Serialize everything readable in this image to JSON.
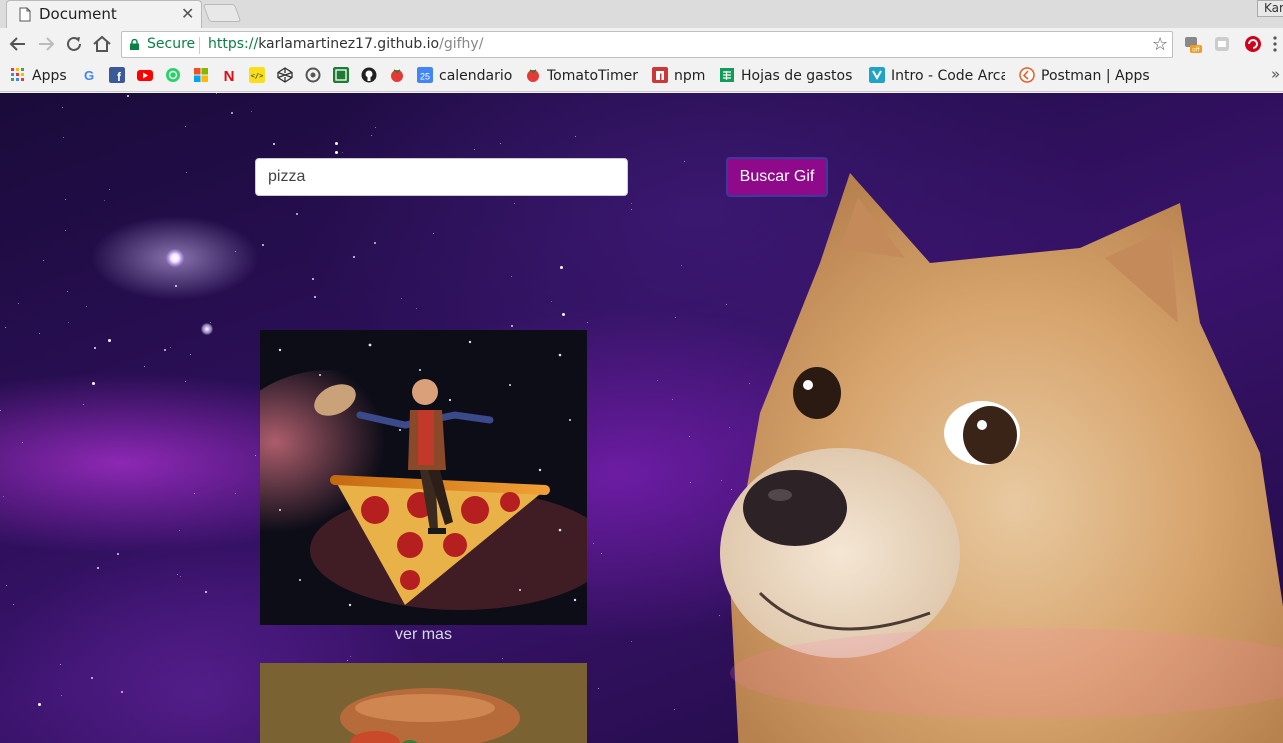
{
  "browser": {
    "tab_title": "Document",
    "window_user": "Kar",
    "secure_label": "Secure",
    "url_scheme": "https://",
    "url_host": "karlamartinez17.github.io",
    "url_path": "/gifhy/"
  },
  "bookmarks": [
    {
      "label": "Apps",
      "icon": "apps-grid-icon",
      "color": "#4285f4"
    },
    {
      "label": "",
      "icon": "google-icon",
      "color": "#4285f4"
    },
    {
      "label": "",
      "icon": "facebook-icon",
      "color": "#3b5998"
    },
    {
      "label": "",
      "icon": "youtube-icon",
      "color": "#ff0000"
    },
    {
      "label": "",
      "icon": "whatsapp-icon",
      "color": "#25d366"
    },
    {
      "label": "",
      "icon": "microsoft-icon",
      "color": "#f25022"
    },
    {
      "label": "",
      "icon": "netflix-icon",
      "color": "#e50914"
    },
    {
      "label": "",
      "icon": "codepen-yellow-icon",
      "color": "#f7df1e"
    },
    {
      "label": "",
      "icon": "codepen-icon",
      "color": "#333333"
    },
    {
      "label": "",
      "icon": "circle-icon",
      "color": "#555555"
    },
    {
      "label": "",
      "icon": "green-box-icon",
      "color": "#1e7b34"
    },
    {
      "label": "",
      "icon": "github-icon",
      "color": "#222222"
    },
    {
      "label": "",
      "icon": "tomato-icon",
      "color": "#e53935"
    },
    {
      "label": "calendario",
      "icon": "calendar-icon",
      "color": "#4285f4"
    },
    {
      "label": "TomatoTimer",
      "icon": "tomato-icon",
      "color": "#e53935"
    },
    {
      "label": "npm",
      "icon": "npm-icon",
      "color": "#cb3837"
    },
    {
      "label": "Hojas de gastos",
      "icon": "sheets-icon",
      "color": "#0f9d58"
    },
    {
      "label": "Intro - Code Arca",
      "icon": "codeacademy-icon",
      "color": "#1fa4c5"
    },
    {
      "label": "Postman | Apps",
      "icon": "postman-icon",
      "color": "#ef5b25"
    }
  ],
  "search": {
    "value": "pizza",
    "button_label": "Buscar Gif"
  },
  "results": {
    "more_label": "ver mas"
  },
  "colors": {
    "button_bg": "#8e0a8a",
    "secure_green": "#0b8043"
  }
}
